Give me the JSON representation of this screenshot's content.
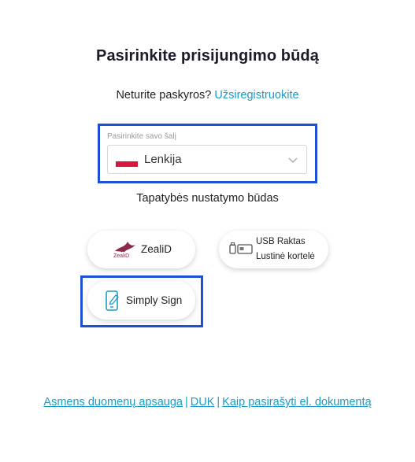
{
  "page": {
    "title": "Pasirinkite prisijungimo būdą",
    "no_account_text": "Neturite paskyros?",
    "register_link": "Užsiregistruokite"
  },
  "country": {
    "label": "Pasirinkite savo šalį",
    "selected": "Lenkija",
    "flag_colors": [
      "#ffffff",
      "#d9163c"
    ]
  },
  "auth": {
    "label": "Tapatybės nustatymo būdas",
    "methods": [
      {
        "name": "ZealiD",
        "logo_text": "ZealiD",
        "icon": "zealid-logo"
      },
      {
        "line1": "USB Raktas",
        "line2": "Lustinė kortelė",
        "icon": "usb-card-icon"
      },
      {
        "name": "Simply Sign",
        "icon": "phone-icon"
      }
    ]
  },
  "footer": {
    "links": [
      "Asmens duomenų apsauga",
      "DUK",
      "Kaip pasirašyti el. dokumentą"
    ],
    "separator": "|"
  },
  "colors": {
    "accent": "#1a9cc8",
    "highlight": "#1d4fd8",
    "zealid": "#8a2b4a"
  }
}
